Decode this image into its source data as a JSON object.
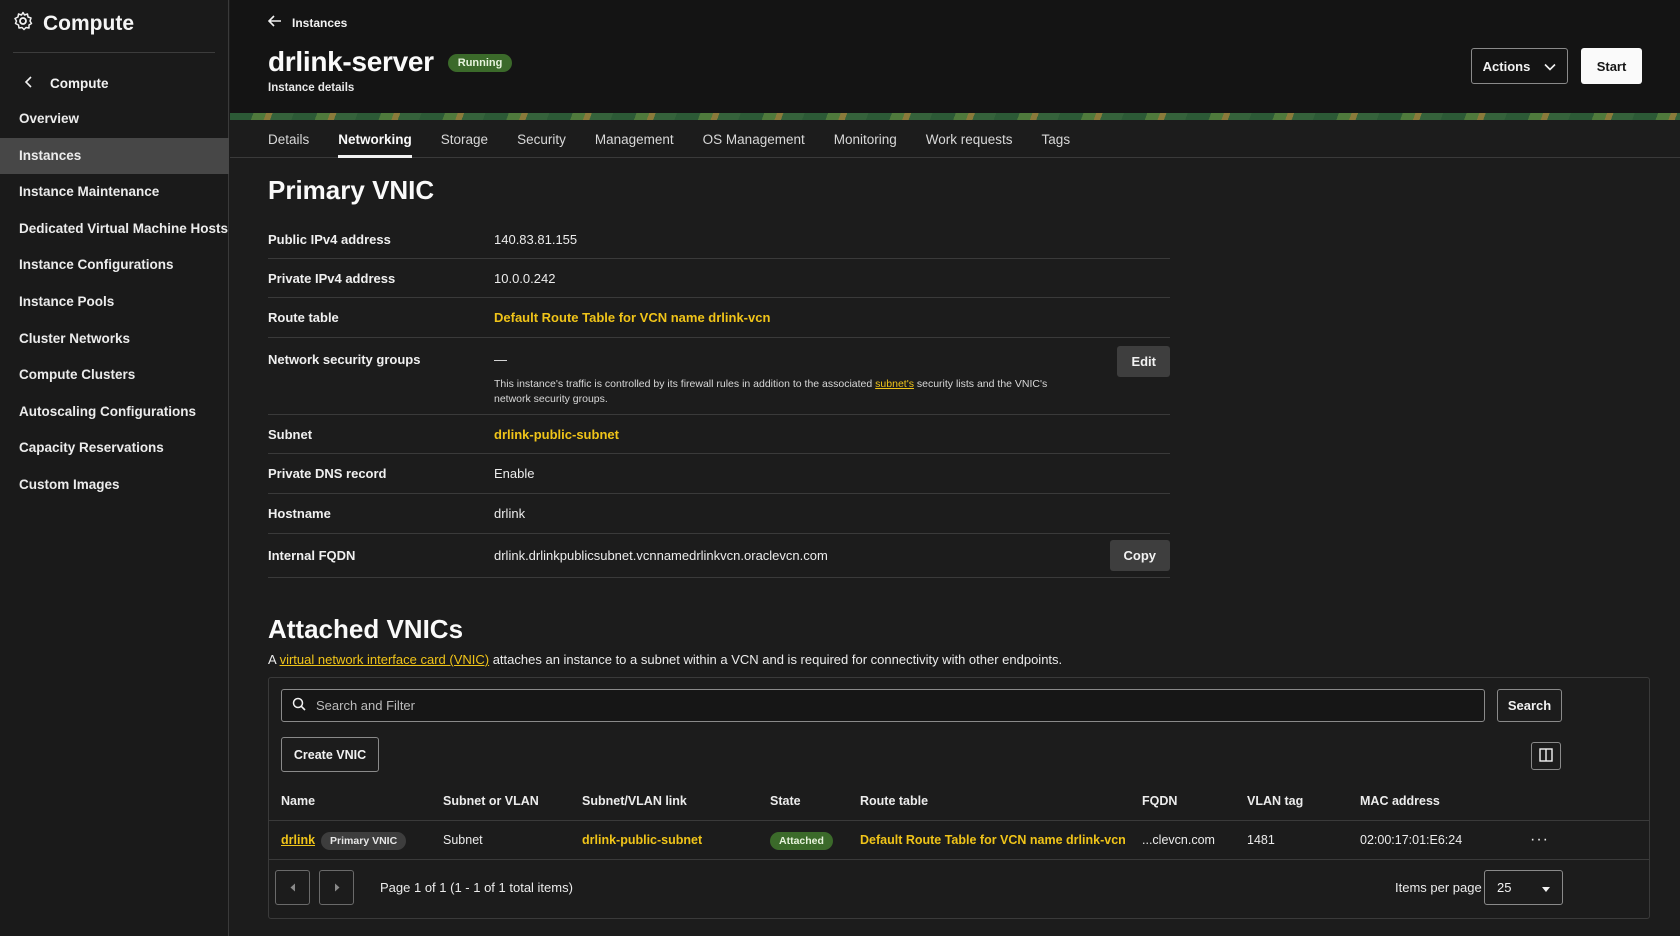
{
  "sidebar": {
    "title": "Compute",
    "back_label": "Compute",
    "items": [
      {
        "label": "Overview"
      },
      {
        "label": "Instances"
      },
      {
        "label": "Instance Maintenance"
      },
      {
        "label": "Dedicated Virtual Machine Hosts"
      },
      {
        "label": "Instance Configurations"
      },
      {
        "label": "Instance Pools"
      },
      {
        "label": "Cluster Networks"
      },
      {
        "label": "Compute Clusters"
      },
      {
        "label": "Autoscaling Configurations"
      },
      {
        "label": "Capacity Reservations"
      },
      {
        "label": "Custom Images"
      }
    ],
    "active_item": "Instances"
  },
  "header": {
    "breadcrumb": "Instances",
    "title": "drlink-server",
    "status": "Running",
    "subtitle": "Instance details",
    "actions_label": "Actions",
    "start_label": "Start"
  },
  "tabs": [
    "Details",
    "Networking",
    "Storage",
    "Security",
    "Management",
    "OS Management",
    "Monitoring",
    "Work requests",
    "Tags"
  ],
  "active_tab": "Networking",
  "primary_vnic": {
    "heading": "Primary VNIC",
    "public_ip_label": "Public IPv4 address",
    "public_ip": "140.83.81.155",
    "private_ip_label": "Private IPv4 address",
    "private_ip": "10.0.0.242",
    "route_table_label": "Route table",
    "route_table": "Default Route Table for VCN name drlink-vcn",
    "nsg_label": "Network security groups",
    "nsg_value": "—",
    "nsg_note_before": "This instance's traffic is controlled by its firewall rules in addition to the associated ",
    "nsg_note_link": "subnet's",
    "nsg_note_after": " security lists and the VNIC's network security groups.",
    "edit_label": "Edit",
    "subnet_label": "Subnet",
    "subnet": "drlink-public-subnet",
    "dns_label": "Private DNS record",
    "dns_value": "Enable",
    "hostname_label": "Hostname",
    "hostname": "drlink",
    "fqdn_label": "Internal FQDN",
    "fqdn": "drlink.drlinkpublicsubnet.vcnnamedrlinkvcn.oraclevcn.com",
    "copy_label": "Copy"
  },
  "attached_vnics": {
    "heading": "Attached VNICs",
    "desc_prefix": "A ",
    "desc_link": "virtual network interface card (VNIC)",
    "desc_suffix": " attaches an instance to a subnet within a VCN and is required for connectivity with other endpoints.",
    "search_placeholder": "Search and Filter",
    "search_button": "Search",
    "create_button": "Create VNIC",
    "columns": [
      "Name",
      "Subnet or VLAN",
      "Subnet/VLAN link",
      "State",
      "Route table",
      "FQDN",
      "VLAN tag",
      "MAC address"
    ],
    "rows": [
      {
        "name": "drlink",
        "tag": "Primary VNIC",
        "subnet_or_vlan": "Subnet",
        "link": "drlink-public-subnet",
        "state": "Attached",
        "route_table": "Default Route Table for VCN name drlink-vcn",
        "fqdn": "...clevcn.com",
        "vlan_tag": "1481",
        "mac": "02:00:17:01:E6:24"
      }
    ],
    "pagination_text": "Page 1 of 1 (1 - 1 of 1 total items)",
    "items_per_page_label": "Items per page",
    "items_per_page": "25"
  },
  "colors": {
    "accent_link": "#f0c419",
    "running_badge": "#3b6a2a",
    "background": "#1c1c1c"
  }
}
